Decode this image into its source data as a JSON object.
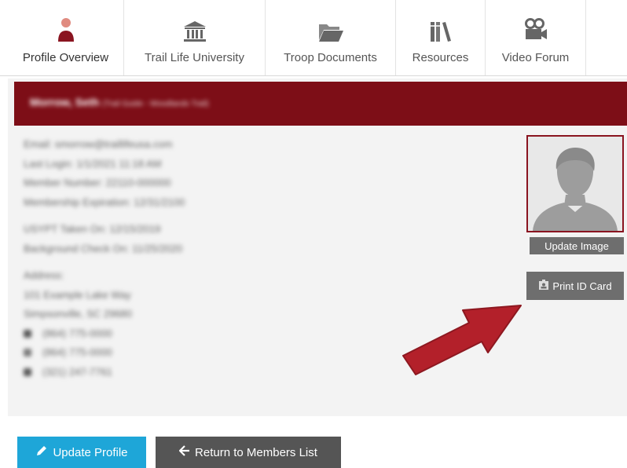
{
  "tabs": [
    {
      "label": "Profile Overview",
      "icon": "user-icon"
    },
    {
      "label": "Trail Life University",
      "icon": "institution-icon"
    },
    {
      "label": "Troop Documents",
      "icon": "folder-open-icon"
    },
    {
      "label": "Resources",
      "icon": "books-icon"
    },
    {
      "label": "Video Forum",
      "icon": "video-camera-icon"
    }
  ],
  "member": {
    "name": "Morrow, Seth",
    "subtitle": "(Trail Guide - Woodlands Trail)"
  },
  "details": {
    "email": "Email: smorrow@traillifeusa.com",
    "last_login": "Last Login: 1/1/2021 11:18 AM",
    "member_number": "Member Number: 22110-000000",
    "membership_expiration": "Membership Expiration: 12/31/2100",
    "yp_date": "USYPT Taken On: 12/15/2019",
    "background_check": "Background Check On: 11/25/2020",
    "address_label": "Address:",
    "address_line1": "101 Example Lake Way",
    "address_line2": "Simpsonville, SC 29680",
    "phone_mobile": "(864) 775-0000",
    "phone_home": "(864) 775-0000",
    "fax": "(321) 247-7761"
  },
  "photo": {
    "update_image_label": "Update Image",
    "print_id_label": "Print ID Card"
  },
  "actions": {
    "update_profile_label": "Update Profile",
    "return_label": "Return to Members List"
  },
  "colors": {
    "brand_maroon": "#7d0e17",
    "accent_blue": "#1ea6d8",
    "arrow_red": "#b3202a"
  }
}
